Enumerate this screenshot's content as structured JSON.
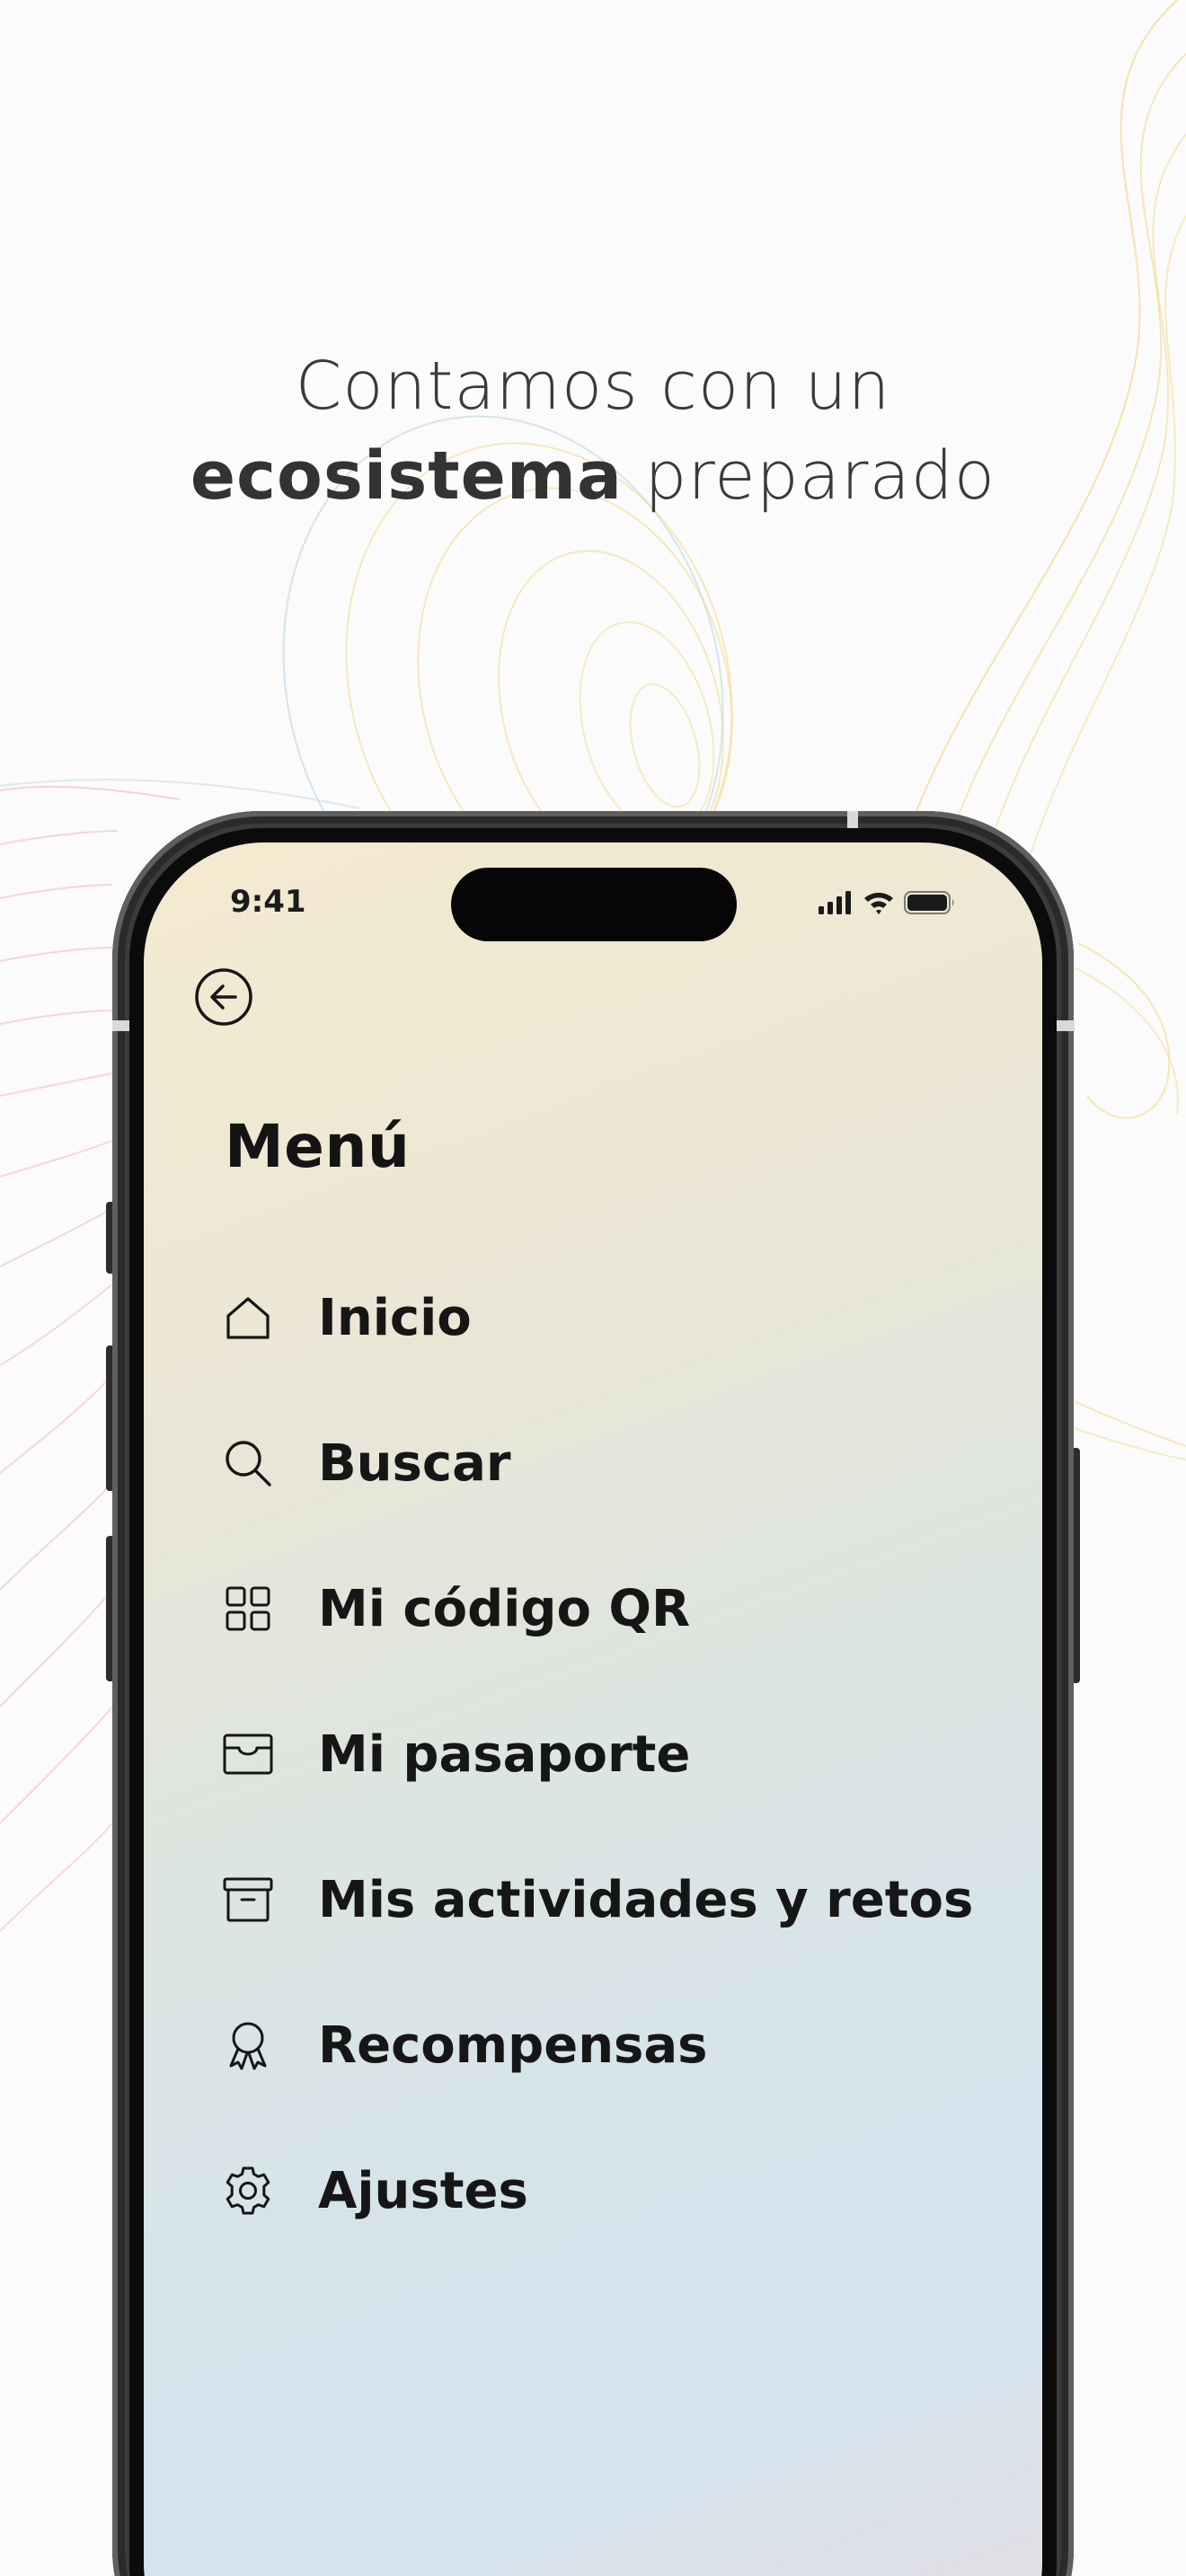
{
  "headline": {
    "line1": "Contamos con un",
    "line2_bold": "ecosistema",
    "line2_rest": " preparado"
  },
  "status_bar": {
    "time": "9:41",
    "icons": [
      "cellular-signal-icon",
      "wifi-icon",
      "battery-icon"
    ]
  },
  "screen": {
    "back_icon": "arrow-left-circle-icon",
    "title": "Menú",
    "menu_items": [
      {
        "label": "Inicio",
        "icon": "home-icon"
      },
      {
        "label": "Buscar",
        "icon": "search-icon"
      },
      {
        "label": "Mi código QR",
        "icon": "grid-icon"
      },
      {
        "label": "Mi pasaporte",
        "icon": "wallet-icon"
      },
      {
        "label": "Mis actividades y retos",
        "icon": "archive-icon"
      },
      {
        "label": "Recompensas",
        "icon": "award-icon"
      },
      {
        "label": "Ajustes",
        "icon": "gear-icon"
      }
    ]
  },
  "colors": {
    "background": "#fbfbfb",
    "text_dark": "#161616",
    "headline": "#3a3a3a",
    "line_yellow": "#f3d98a",
    "line_pink": "#f0b8c4",
    "line_blue": "#b9d7e6",
    "gradient_top": "#f5ead0",
    "gradient_bottom": "#d3e4ee"
  }
}
